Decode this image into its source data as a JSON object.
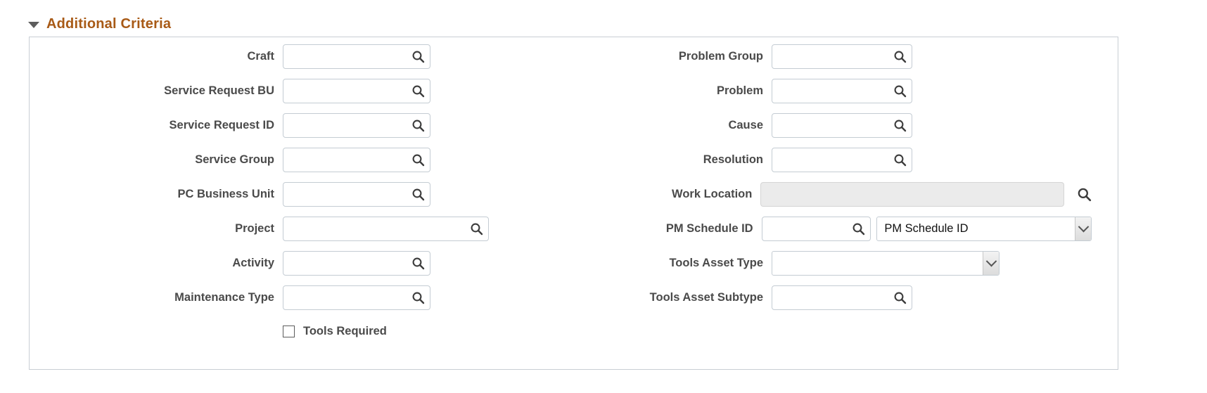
{
  "section": {
    "title": "Additional Criteria",
    "expanded": true,
    "disclosure_icon": "triangle-down-icon",
    "title_color": "#a85a16"
  },
  "left_column": [
    {
      "label": "Craft",
      "type": "lookup",
      "value": "",
      "icon": "search-icon",
      "width": "w-210"
    },
    {
      "label": "Service Request BU",
      "type": "lookup",
      "value": "",
      "icon": "search-icon",
      "width": "w-210"
    },
    {
      "label": "Service Request ID",
      "type": "lookup",
      "value": "",
      "icon": "search-icon",
      "width": "w-210"
    },
    {
      "label": "Service Group",
      "type": "lookup",
      "value": "",
      "icon": "search-icon",
      "width": "w-210"
    },
    {
      "label": "PC Business Unit",
      "type": "lookup",
      "value": "",
      "icon": "search-icon",
      "width": "w-210"
    },
    {
      "label": "Project",
      "type": "lookup",
      "value": "",
      "icon": "search-icon",
      "width": "w-293"
    },
    {
      "label": "Activity",
      "type": "lookup",
      "value": "",
      "icon": "search-icon",
      "width": "w-210"
    },
    {
      "label": "Maintenance Type",
      "type": "lookup",
      "value": "",
      "icon": "search-icon",
      "width": "w-210"
    }
  ],
  "right_column": [
    {
      "label": "Problem Group",
      "type": "lookup",
      "value": "",
      "icon": "search-icon",
      "width": "w-200"
    },
    {
      "label": "Problem",
      "type": "lookup",
      "value": "",
      "icon": "search-icon",
      "width": "w-200"
    },
    {
      "label": "Cause",
      "type": "lookup",
      "value": "",
      "icon": "search-icon",
      "width": "w-200"
    },
    {
      "label": "Resolution",
      "type": "lookup",
      "value": "",
      "icon": "search-icon",
      "width": "w-200"
    },
    {
      "label": "Work Location",
      "type": "disabled-lookup-external",
      "value": "",
      "icon": "search-icon",
      "width": "w-460",
      "disabled": true
    },
    {
      "label": "PM Schedule ID",
      "type": "lookup-plus-select",
      "value": "",
      "icon": "search-icon",
      "width": "w-165",
      "select_value": "PM Schedule ID",
      "select_icon": "chevron-down-icon"
    },
    {
      "label": "Tools Asset Type",
      "type": "select",
      "select_value": "",
      "select_icon": "chevron-down-icon",
      "width": "w-sel-324"
    },
    {
      "label": "Tools Asset Subtype",
      "type": "lookup",
      "value": "",
      "icon": "search-icon",
      "width": "w-200"
    }
  ],
  "checkbox": {
    "label": "Tools Required",
    "checked": false
  }
}
